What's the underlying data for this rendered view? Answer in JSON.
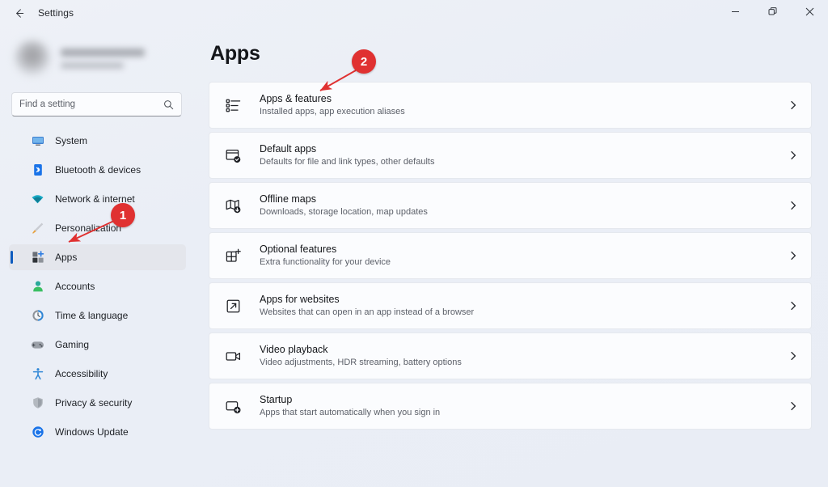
{
  "window": {
    "title": "Settings",
    "back_icon": "back-arrow-icon",
    "controls": {
      "minimize": "minimize-icon",
      "maximize": "restore-icon",
      "close": "close-icon"
    }
  },
  "sidebar": {
    "profile": {
      "redacted": true,
      "avatar": "user-avatar"
    },
    "search": {
      "placeholder": "Find a setting",
      "value": "",
      "icon": "search-icon"
    },
    "items": [
      {
        "label": "System",
        "icon": "monitor-icon",
        "selected": false
      },
      {
        "label": "Bluetooth & devices",
        "icon": "bluetooth-icon",
        "selected": false
      },
      {
        "label": "Network & internet",
        "icon": "wifi-icon",
        "selected": false
      },
      {
        "label": "Personalization",
        "icon": "paintbrush-icon",
        "selected": false
      },
      {
        "label": "Apps",
        "icon": "apps-icon",
        "selected": true
      },
      {
        "label": "Accounts",
        "icon": "person-icon",
        "selected": false
      },
      {
        "label": "Time & language",
        "icon": "clock-icon",
        "selected": false
      },
      {
        "label": "Gaming",
        "icon": "gamepad-icon",
        "selected": false
      },
      {
        "label": "Accessibility",
        "icon": "accessibility-icon",
        "selected": false
      },
      {
        "label": "Privacy & security",
        "icon": "shield-icon",
        "selected": false
      },
      {
        "label": "Windows Update",
        "icon": "update-icon",
        "selected": false
      }
    ]
  },
  "main": {
    "title": "Apps",
    "cards": [
      {
        "title": "Apps & features",
        "subtitle": "Installed apps, app execution aliases",
        "icon": "app-list-icon",
        "chevron": "chevron-right-icon"
      },
      {
        "title": "Default apps",
        "subtitle": "Defaults for file and link types, other defaults",
        "icon": "default-apps-icon",
        "chevron": "chevron-right-icon"
      },
      {
        "title": "Offline maps",
        "subtitle": "Downloads, storage location, map updates",
        "icon": "map-download-icon",
        "chevron": "chevron-right-icon"
      },
      {
        "title": "Optional features",
        "subtitle": "Extra functionality for your device",
        "icon": "optional-features-icon",
        "chevron": "chevron-right-icon"
      },
      {
        "title": "Apps for websites",
        "subtitle": "Websites that can open in an app instead of a browser",
        "icon": "external-link-icon",
        "chevron": "chevron-right-icon"
      },
      {
        "title": "Video playback",
        "subtitle": "Video adjustments, HDR streaming, battery options",
        "icon": "video-camera-icon",
        "chevron": "chevron-right-icon"
      },
      {
        "title": "Startup",
        "subtitle": "Apps that start automatically when you sign in",
        "icon": "startup-icon",
        "chevron": "chevron-right-icon"
      }
    ]
  },
  "annotations": {
    "color": "#e03131",
    "markers": [
      {
        "label": "1",
        "target": "sidebar-item-apps"
      },
      {
        "label": "2",
        "target": "card-apps-and-features"
      }
    ]
  },
  "colors": {
    "accent": "#0d5bbe",
    "annotation_red": "#e03131",
    "page_background": "#eef1f7",
    "card_background": "#fbfcfe"
  }
}
